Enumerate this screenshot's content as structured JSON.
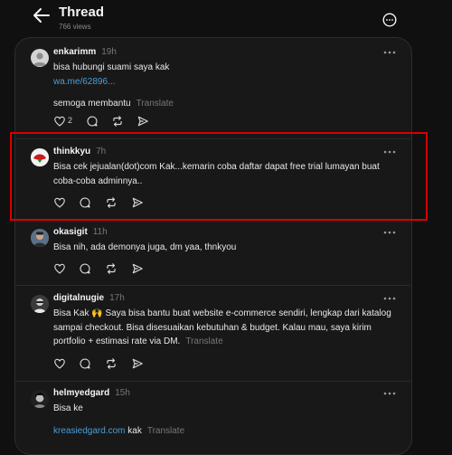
{
  "header": {
    "title": "Thread",
    "views": "766 views"
  },
  "posts": [
    {
      "username": "enkarimm",
      "time": "19h",
      "line1": "bisa hubungi suami saya kak",
      "link": "wa.me/62896...",
      "line2": "semoga membantu",
      "translate": "Translate",
      "like_count": "2"
    },
    {
      "username": "thinkkyu",
      "time": "7h",
      "text": "Bisa cek jejualan(dot)com Kak...kemarin coba daftar dapat free trial lumayan buat coba-coba adminnya.."
    },
    {
      "username": "okasigit",
      "time": "11h",
      "text": "Bisa nih, ada demonya juga, dm yaa, thnkyou"
    },
    {
      "username": "digitalnugie",
      "time": "17h",
      "text": "Bisa Kak 🙌 Saya bisa bantu buat website e-commerce sendiri, lengkap dari katalog sampai checkout. Bisa disesuaikan kebutuhan & budget. Kalau mau, saya kirim portfolio + estimasi rate via DM.",
      "translate": "Translate"
    },
    {
      "username": "helmyedgard",
      "time": "15h",
      "line1": "Bisa ke",
      "link": "kreasiedgard.com",
      "after_link": "kak",
      "translate": "Translate"
    }
  ],
  "colors": {
    "background": "#101010",
    "panel": "#181818",
    "link": "#4a9fd8",
    "highlight": "#d90000"
  },
  "icons": [
    "back-arrow-icon",
    "more-circle-icon",
    "more-dots-icon",
    "heart-icon",
    "comment-icon",
    "repost-icon",
    "share-icon"
  ]
}
